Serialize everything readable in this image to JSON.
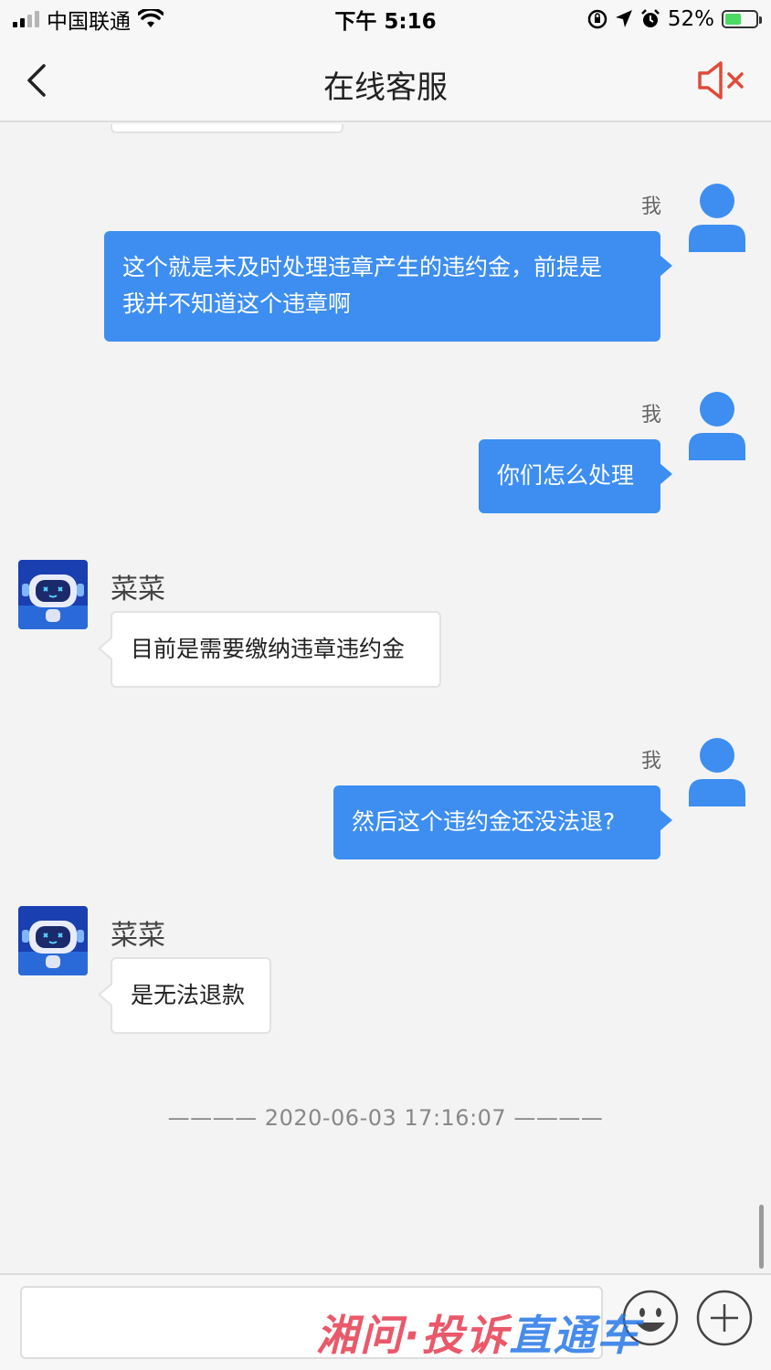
{
  "status_bar": {
    "carrier": "中国联通",
    "time": "下午 5:16",
    "battery": "52%",
    "battery_level": 0.52
  },
  "nav": {
    "title": "在线客服"
  },
  "messages": [
    {
      "from": "me",
      "sender_label": "我",
      "text_line1": "这个就是未及时处理违章产生的违约金，前提是",
      "text_line2": "我并不知道这个违章啊"
    },
    {
      "from": "me",
      "sender_label": "我",
      "text": "你们怎么处理"
    },
    {
      "from": "bot",
      "sender_name": "菜菜",
      "text": "目前是需要缴纳违章违约金"
    },
    {
      "from": "me",
      "sender_label": "我",
      "text": "然后这个违约金还没法退?"
    },
    {
      "from": "bot",
      "sender_name": "菜菜",
      "text": "是无法退款"
    }
  ],
  "timestamp": "———— 2020-06-03 17:16:07 ————",
  "input": {
    "value": ""
  },
  "watermark": {
    "text_a": "湘问·投诉",
    "text_b": "直通车"
  },
  "colors": {
    "accent": "#3d8ef0",
    "mute_icon": "#e04a3a"
  }
}
